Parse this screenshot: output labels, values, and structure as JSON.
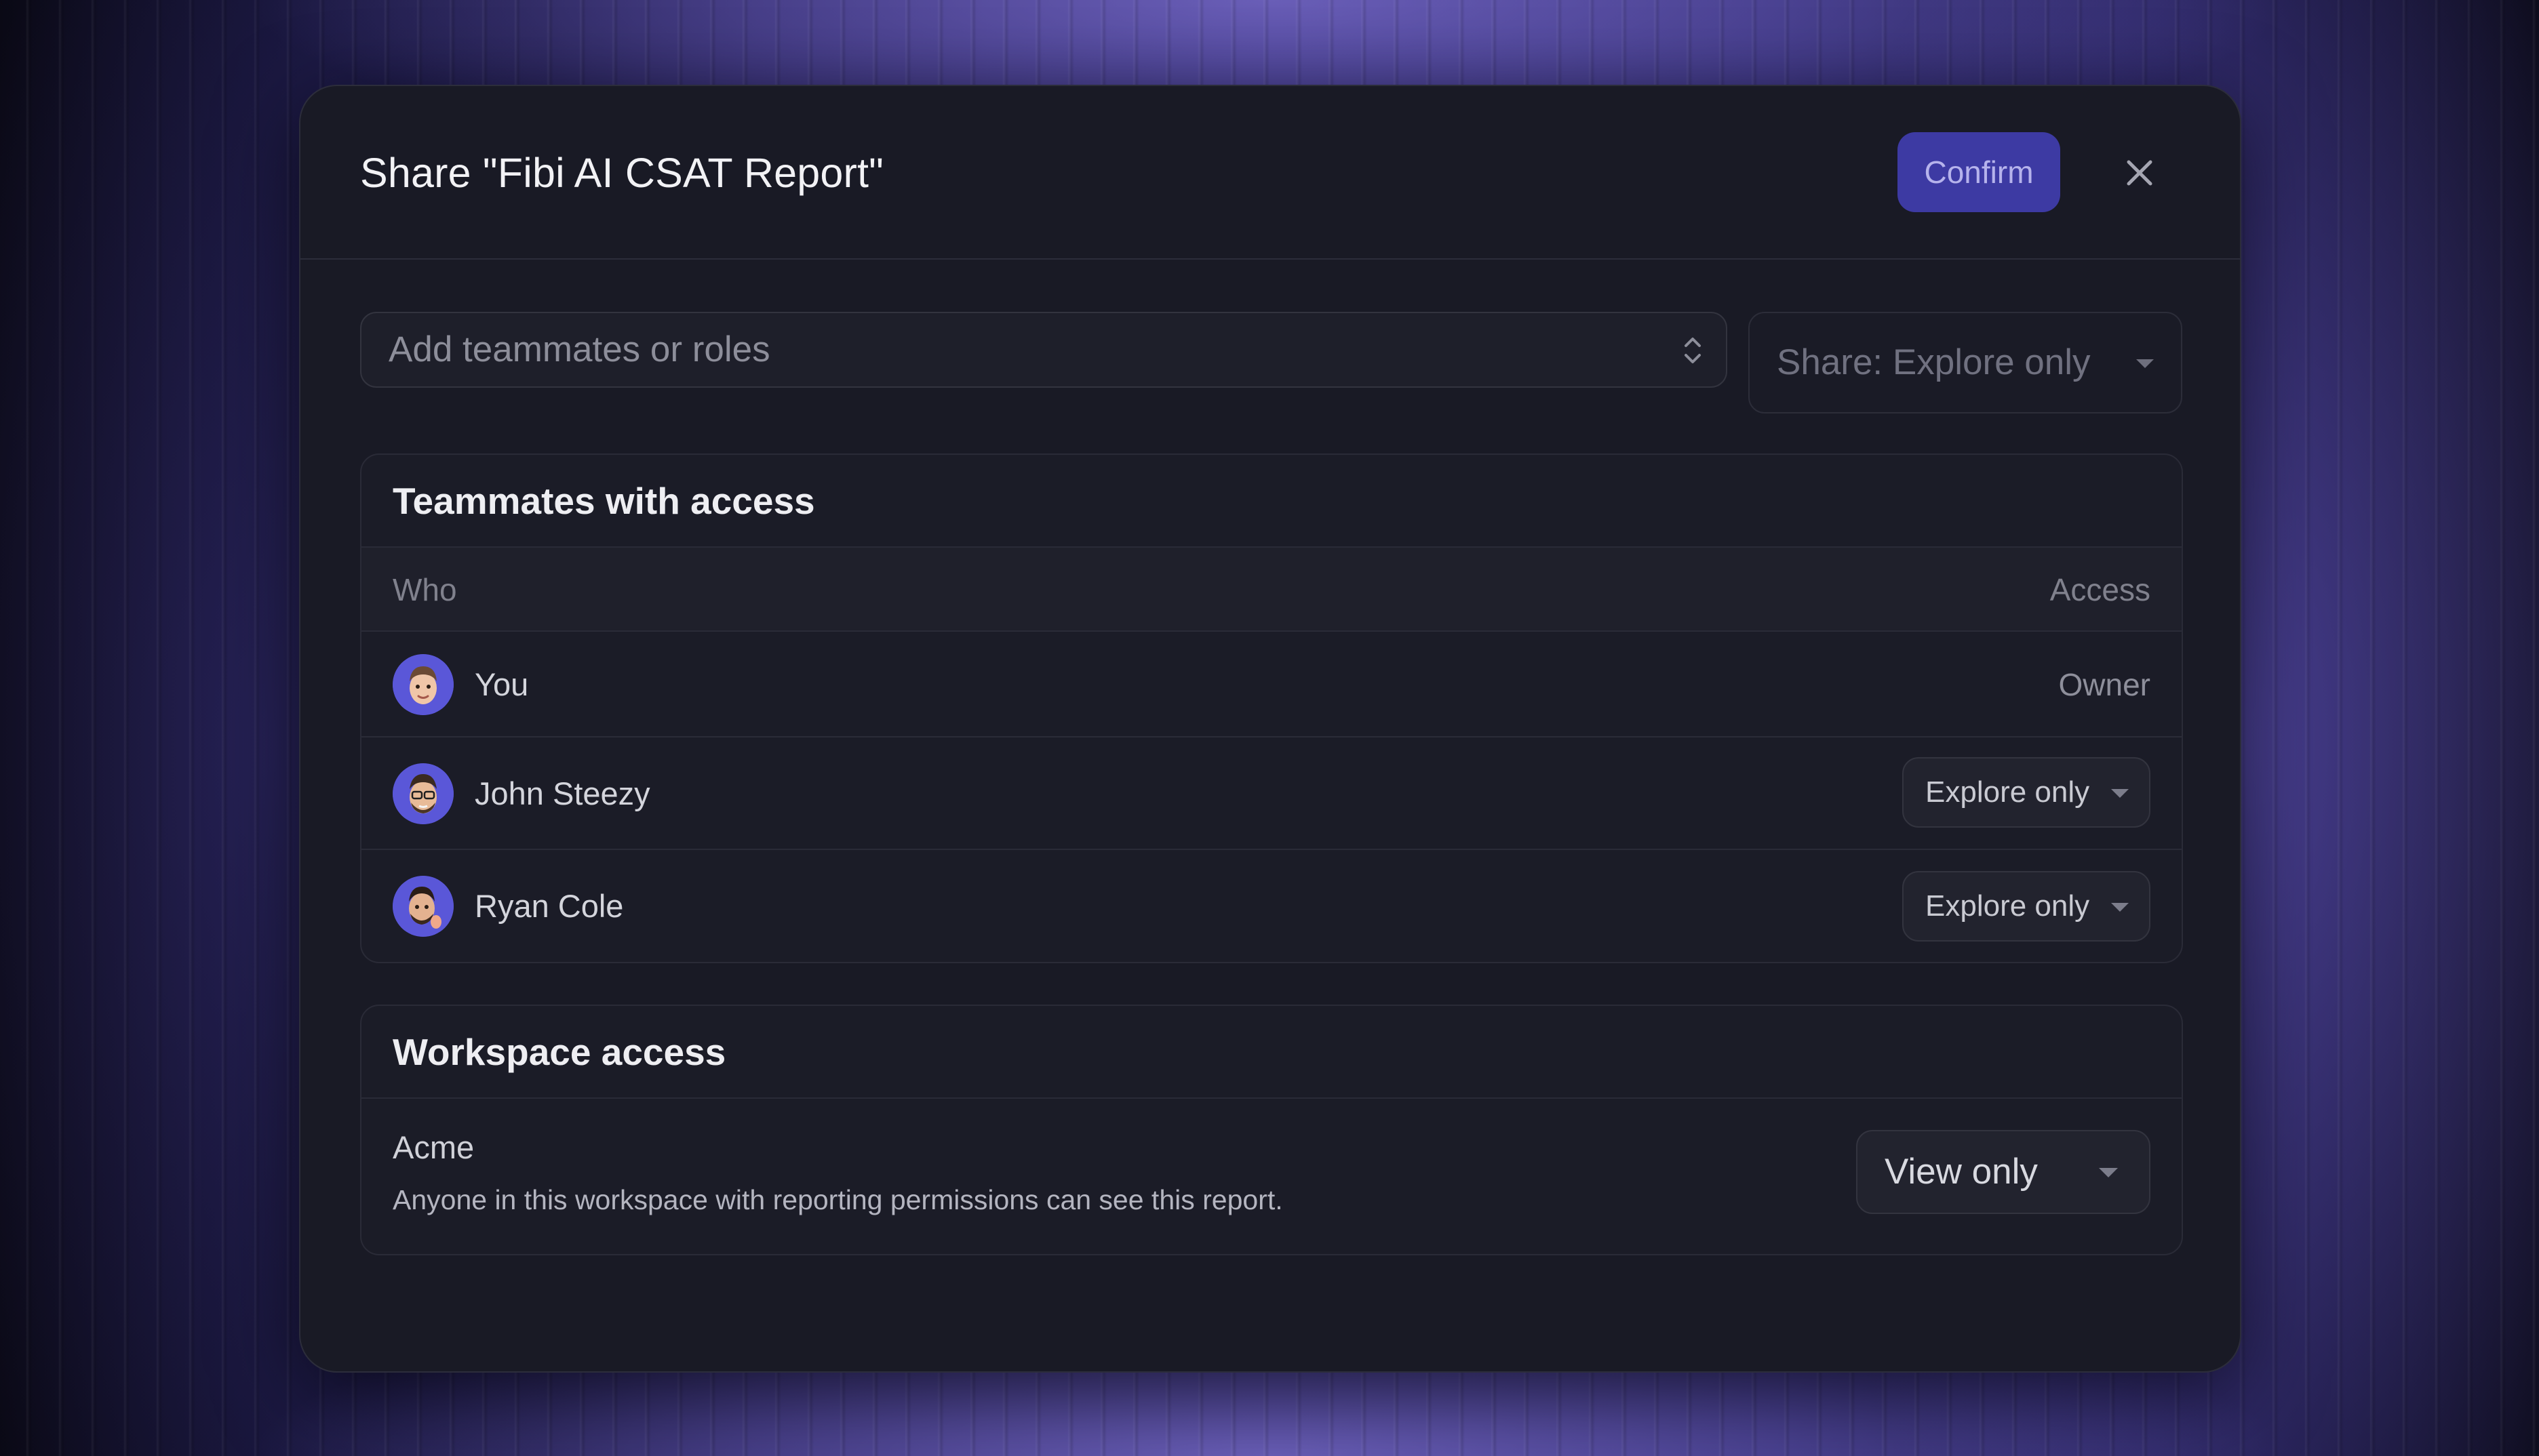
{
  "dialog": {
    "title": "Share \"Fibi AI CSAT Report\"",
    "confirm_label": "Confirm"
  },
  "search": {
    "placeholder": "Add teammates or roles"
  },
  "share_mode": {
    "label": "Share: Explore only"
  },
  "teammates": {
    "section_title": "Teammates with access",
    "col_who": "Who",
    "col_access": "Access",
    "rows": [
      {
        "name": "You",
        "access": "Owner"
      },
      {
        "name": "John Steezy",
        "access": "Explore only"
      },
      {
        "name": "Ryan Cole",
        "access": "Explore only"
      }
    ]
  },
  "workspace": {
    "section_title": "Workspace access",
    "name": "Acme",
    "description": "Anyone in this workspace with reporting permissions can see this report.",
    "access": "View only"
  },
  "colors": {
    "accent": "#3d3aa3",
    "avatar_bg": "#5a57d8"
  }
}
